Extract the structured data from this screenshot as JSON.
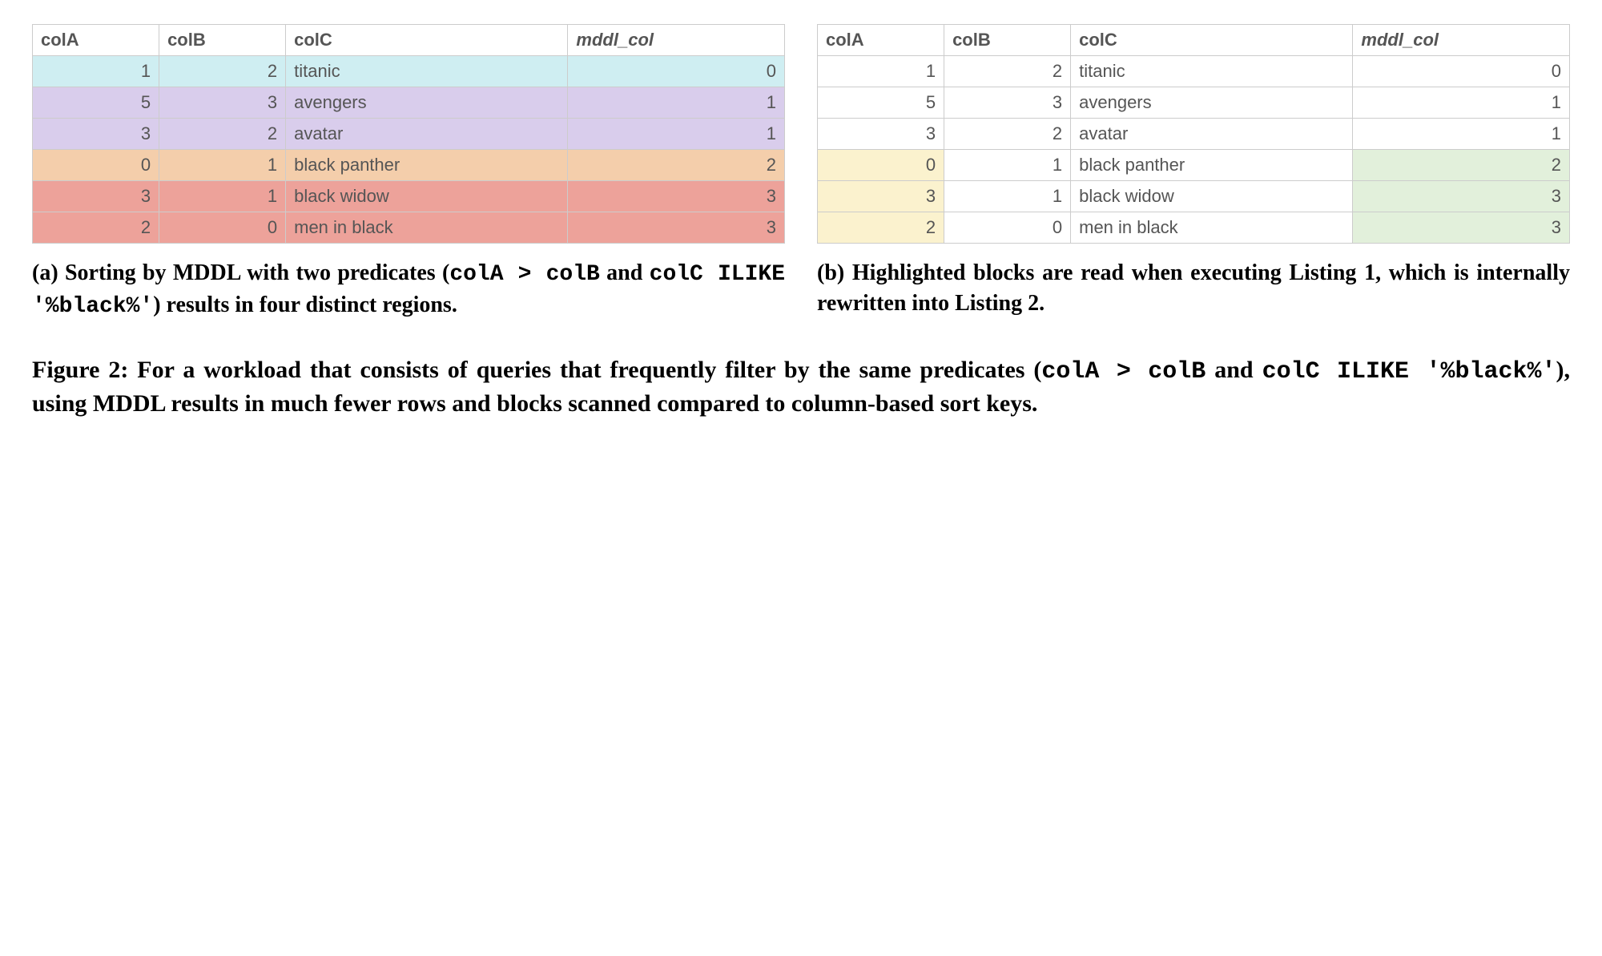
{
  "headers": {
    "colA": "colA",
    "colB": "colB",
    "colC": "colC",
    "mddl": "mddl_col"
  },
  "rows": [
    {
      "colA": "1",
      "colB": "2",
      "colC": "titanic",
      "mddl": "0"
    },
    {
      "colA": "5",
      "colB": "3",
      "colC": "avengers",
      "mddl": "1"
    },
    {
      "colA": "3",
      "colB": "2",
      "colC": "avatar",
      "mddl": "1"
    },
    {
      "colA": "0",
      "colB": "1",
      "colC": "black panther",
      "mddl": "2"
    },
    {
      "colA": "3",
      "colB": "1",
      "colC": "black widow",
      "mddl": "3"
    },
    {
      "colA": "2",
      "colB": "0",
      "colC": "men in black",
      "mddl": "3"
    }
  ],
  "left_row_colors": [
    "bg-cyan",
    "bg-purple",
    "bg-purple",
    "bg-orange",
    "bg-red",
    "bg-red"
  ],
  "right_highlights": [
    {
      "colA": false,
      "mddl": false
    },
    {
      "colA": false,
      "mddl": false
    },
    {
      "colA": false,
      "mddl": false
    },
    {
      "colA": true,
      "mddl": true
    },
    {
      "colA": true,
      "mddl": true
    },
    {
      "colA": true,
      "mddl": true
    }
  ],
  "caption_a": {
    "prefix": "(a) Sorting by MDDL with two predicates (",
    "code1": "colA > colB",
    "mid": " and ",
    "code2": "colC ILIKE '%black%'",
    "suffix": ") results in four distinct regions."
  },
  "caption_b": {
    "text": "(b) Highlighted blocks are read when executing Listing 1, which is internally rewritten into Listing 2."
  },
  "caption_main": {
    "prefix": "Figure 2: For a workload that consists of queries that frequently filter by the same predicates (",
    "code1": "colA > colB",
    "mid": " and ",
    "code2": "colC ILIKE '%black%'",
    "suffix": "), using MDDL results in much fewer rows and blocks scanned compared to column-based sort keys."
  }
}
